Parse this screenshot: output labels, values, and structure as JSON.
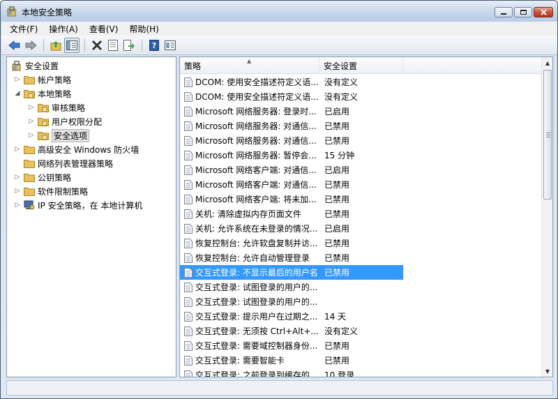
{
  "window": {
    "title": "本地安全策略"
  },
  "menu": [
    "文件(F)",
    "操作(A)",
    "查看(V)",
    "帮助(H)"
  ],
  "toolbar": {
    "icons": [
      "back-arrow-icon",
      "forward-arrow-icon",
      "up-folder-icon",
      "show-tree-icon",
      "delete-icon",
      "properties-icon",
      "export-icon",
      "help-icon",
      "view-icon"
    ]
  },
  "tree": [
    {
      "label": "安全设置",
      "level": 0,
      "toggle": "",
      "icon": "security-settings-icon"
    },
    {
      "label": "帐户策略",
      "level": 1,
      "toggle": "▷",
      "icon": "folder-icon"
    },
    {
      "label": "本地策略",
      "level": 1,
      "toggle": "◢",
      "icon": "folder-icon"
    },
    {
      "label": "审核策略",
      "level": 2,
      "toggle": "▷",
      "icon": "folder-icon"
    },
    {
      "label": "用户权限分配",
      "level": 2,
      "toggle": "▷",
      "icon": "folder-icon"
    },
    {
      "label": "安全选项",
      "level": 2,
      "toggle": "▷",
      "icon": "folder-icon",
      "selected": true
    },
    {
      "label": "高级安全 Windows 防火墙",
      "level": 1,
      "toggle": "▷",
      "icon": "folder-icon"
    },
    {
      "label": "网络列表管理器策略",
      "level": 1,
      "toggle": "",
      "icon": "folder-icon"
    },
    {
      "label": "公钥策略",
      "level": 1,
      "toggle": "▷",
      "icon": "folder-icon"
    },
    {
      "label": "软件限制策略",
      "level": 1,
      "toggle": "▷",
      "icon": "folder-icon"
    },
    {
      "label": "IP 安全策略，在 本地计算机",
      "level": 1,
      "toggle": "▷",
      "icon": "ip-policy-icon"
    }
  ],
  "list": {
    "columns": [
      "策略",
      "安全设置"
    ],
    "rows": [
      {
        "policy": "DCOM: 使用安全描述符定义语...",
        "setting": "没有定义"
      },
      {
        "policy": "DCOM: 使用安全描述符定义语...",
        "setting": "没有定义"
      },
      {
        "policy": "Microsoft 网络服务器: 登录时...",
        "setting": "已启用"
      },
      {
        "policy": "Microsoft 网络服务器: 对通信...",
        "setting": "已禁用"
      },
      {
        "policy": "Microsoft 网络服务器: 对通信...",
        "setting": "已禁用"
      },
      {
        "policy": "Microsoft 网络服务器: 暂停会...",
        "setting": "15 分钟"
      },
      {
        "policy": "Microsoft 网络客户端: 对通信...",
        "setting": "已启用"
      },
      {
        "policy": "Microsoft 网络客户端: 对通信...",
        "setting": "已禁用"
      },
      {
        "policy": "Microsoft 网络客户端: 将未加...",
        "setting": "已禁用"
      },
      {
        "policy": "关机: 清除虚拟内存页面文件",
        "setting": "已禁用"
      },
      {
        "policy": "关机: 允许系统在未登录的情况...",
        "setting": "已启用"
      },
      {
        "policy": "恢复控制台: 允许软盘复制并访...",
        "setting": "已禁用"
      },
      {
        "policy": "恢复控制台: 允许自动管理登录",
        "setting": "已禁用"
      },
      {
        "policy": "交互式登录: 不显示最后的用户名",
        "setting": "已禁用",
        "selected": true
      },
      {
        "policy": "交互式登录: 试图登录的用户的...",
        "setting": ""
      },
      {
        "policy": "交互式登录: 试图登录的用户的...",
        "setting": ""
      },
      {
        "policy": "交互式登录: 提示用户在过期之...",
        "setting": "14 天"
      },
      {
        "policy": "交互式登录: 无须按 Ctrl+Alt+...",
        "setting": "没有定义"
      },
      {
        "policy": "交互式登录: 需要域控制器身份...",
        "setting": "已禁用"
      },
      {
        "policy": "交互式登录: 需要智能卡",
        "setting": "已禁用"
      },
      {
        "policy": "交互式登录: 之前登录到缓存的...",
        "setting": "10 登录"
      }
    ]
  },
  "colors": {
    "selection": "#3399ff",
    "folder": "#e8c15c"
  }
}
